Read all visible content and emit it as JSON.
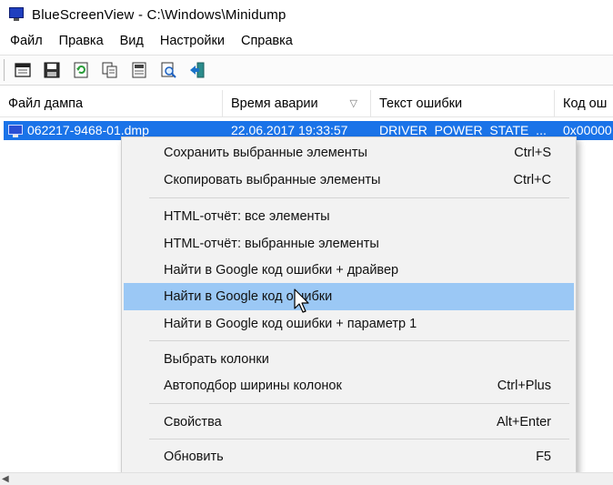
{
  "window": {
    "title": "BlueScreenView  -  C:\\Windows\\Minidump",
    "icon": "monitor-icon"
  },
  "menubar": {
    "items": [
      "Файл",
      "Правка",
      "Вид",
      "Настройки",
      "Справка"
    ]
  },
  "toolbar": {
    "buttons": [
      "properties-window-icon",
      "save-icon",
      "refresh-icon",
      "copy-icon",
      "report-icon",
      "find-icon",
      "exit-icon"
    ]
  },
  "list": {
    "columns": [
      "Файл дампа",
      "Время аварии",
      "Текст ошибки",
      "Код ош"
    ],
    "rows": [
      {
        "file": "062217-9468-01.dmp",
        "time": "22.06.2017 19:33:57",
        "text": "DRIVER_POWER_STATE_...",
        "code": "0x00000"
      }
    ]
  },
  "context_menu": {
    "items": [
      {
        "label": "Сохранить выбранные элементы",
        "shortcut": "Ctrl+S"
      },
      {
        "label": "Скопировать выбранные элементы",
        "shortcut": "Ctrl+C"
      },
      {
        "label": "HTML-отчёт: все элементы",
        "shortcut": ""
      },
      {
        "label": "HTML-отчёт: выбранные элементы",
        "shortcut": ""
      },
      {
        "label": "Найти в Google код ошибки + драйвер",
        "shortcut": ""
      },
      {
        "label": "Найти в Google код ошибки",
        "shortcut": ""
      },
      {
        "label": "Найти в Google код ошибки + параметр 1",
        "shortcut": ""
      },
      {
        "label": "Выбрать колонки",
        "shortcut": ""
      },
      {
        "label": "Автоподбор ширины колонок",
        "shortcut": "Ctrl+Plus"
      },
      {
        "label": "Свойства",
        "shortcut": "Alt+Enter"
      },
      {
        "label": "Обновить",
        "shortcut": "F5"
      }
    ],
    "highlighted_index": 5
  },
  "colors": {
    "selection": "#1a73e8",
    "menu_hover": "#9bc8f5",
    "menu_background": "#f2f2f2"
  }
}
